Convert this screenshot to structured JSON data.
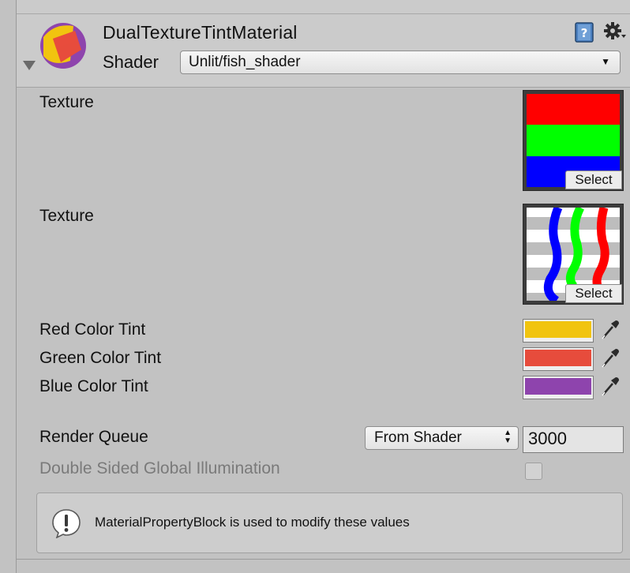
{
  "header": {
    "title": "DualTextureTintMaterial",
    "shader_label": "Shader",
    "shader_value": "Unlit/fish_shader",
    "icons": [
      "material-preview-icon",
      "help-book-icon",
      "gear-icon",
      "foldout-arrow-icon"
    ]
  },
  "properties": {
    "texture1": {
      "label": "Texture",
      "select_label": "Select",
      "stripes": [
        "#ff0000",
        "#00ff00",
        "#0000ff"
      ]
    },
    "texture2": {
      "label": "Texture",
      "select_label": "Select",
      "wave_colors": [
        "#0000ff",
        "#00ff00",
        "#ff0000"
      ]
    },
    "red_tint": {
      "label": "Red Color Tint",
      "color": "#f1c40f"
    },
    "green_tint": {
      "label": "Green Color Tint",
      "color": "#e74c3c"
    },
    "blue_tint": {
      "label": "Blue Color Tint",
      "color": "#8e44ad"
    }
  },
  "render_queue": {
    "label": "Render Queue",
    "mode": "From Shader",
    "value": "3000"
  },
  "dsgi": {
    "label": "Double Sided Global Illumination",
    "checked": false
  },
  "helpbox": {
    "message": "MaterialPropertyBlock is used to modify these values"
  }
}
